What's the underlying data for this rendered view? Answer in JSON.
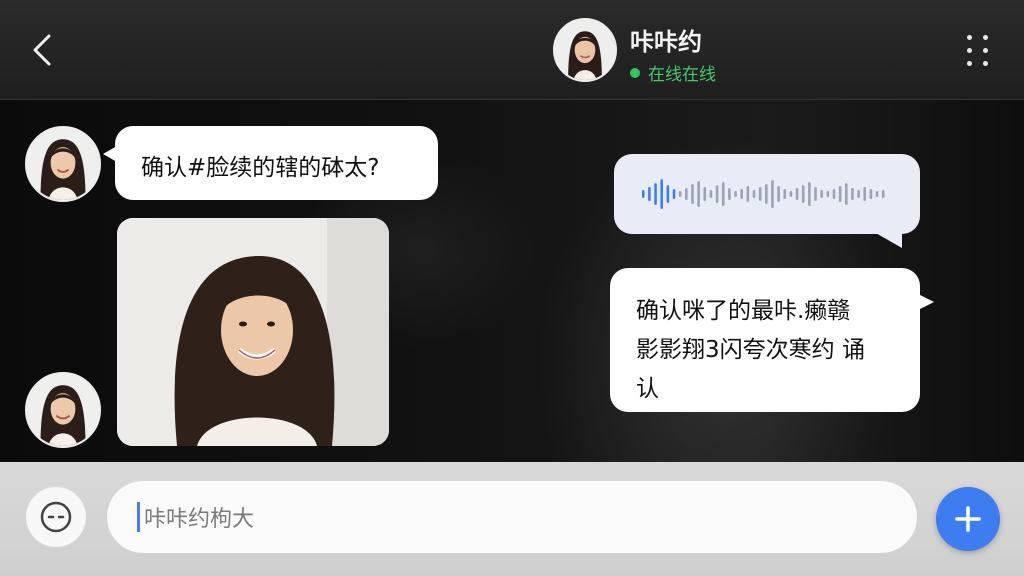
{
  "header": {
    "contact_name": "咔咔约",
    "status": "在线在线",
    "avatar_icon": "avatar-woman-icon",
    "back_icon": "chevron-left-icon",
    "menu_icon": "more-vertical-icon"
  },
  "messages": [
    {
      "direction": "incoming",
      "type": "text",
      "text": "确认#脸续的辖的砵太?"
    },
    {
      "direction": "incoming",
      "type": "image",
      "description_icon": "photo-woman-smiling"
    },
    {
      "direction": "outgoing",
      "type": "voice",
      "icon": "waveform-icon"
    },
    {
      "direction": "outgoing",
      "type": "text",
      "lines": [
        "确认咪了的最咔.癞赣",
        "影影翔3闪夸次寒约 诵",
        "认"
      ]
    }
  ],
  "composer": {
    "value": "咔咔约枸大",
    "emoji_icon": "emoji-icon",
    "add_icon": "plus-icon"
  },
  "colors": {
    "accent": "#3d7df0",
    "online": "#35c45a",
    "voice_bubble": "#e7ecf7"
  }
}
